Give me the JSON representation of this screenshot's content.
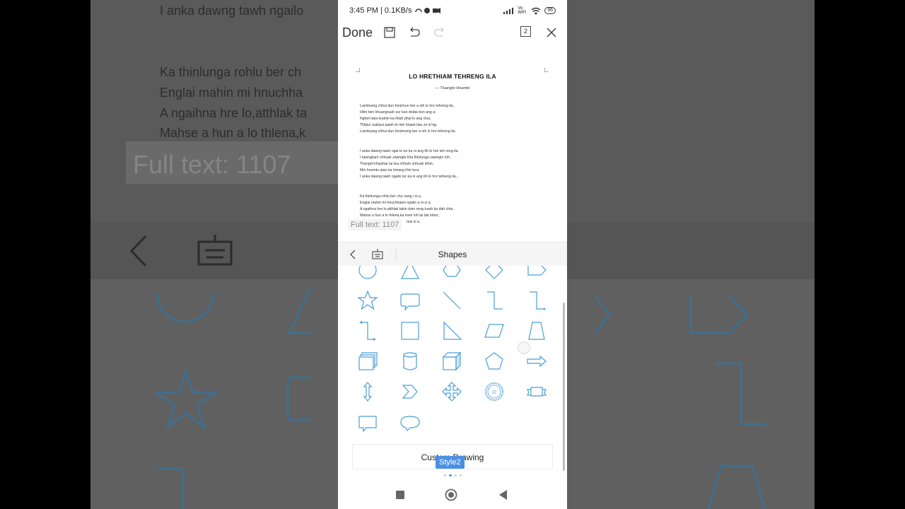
{
  "background": {
    "lines": [
      "I anka dawng tawh ngailo",
      "Ka thinlunga rohlu ber  ch",
      "Englai mahin mi hnuchha",
      "A ngaihna hre lo,atthlak ta",
      "Mahse a hun a lo thlena,k"
    ],
    "full_text": "Full text: 1107"
  },
  "status_bar": {
    "time_speed": "3:45 PM | 0.1KB/s",
    "network": "Vo WiFi",
    "battery": "96"
  },
  "toolbar": {
    "done_label": "Done",
    "page_count": "2"
  },
  "document": {
    "title": "LO HRETHIAM TEHRENG ILA",
    "author": "— Tluangte Hnamte",
    "lines": [
      "Lamtluang chhui dun hnuhnun ber a nih lo hre tehreng ila,",
      "Hlim tein khuangruah sur kan dodai dun ang a;",
      "Nghet taka kuahin ka thlah phal lo ang chia,",
      "Thlipui ruahpui pawh-in min hnawt ṭiau zo lo'ng;",
      "Lamtluang chhui dun hnuhnung ber a nih lo hre tehreng ila.",
      "I anka dawng tawh ngai lo tur ka ni ang tih lo hre teh reng ila,",
      "I tawngkam chhuak zawngte kha thinlunga vawngin loh;",
      "Thangril khawhar lai tea chham chhuak lehin,",
      "Min hnemtu atan ka hmang thin tura;",
      "I anka dawng tawh ngailo tur ka ni ang tih lo hre tehreng ila...",
      "Ka thinlunga rohlu ber  chu nang i ni a,",
      "Englai mahin mi hnuchhawn ngailo a ni si a;",
      "A ngaihna hre lo,atthlak takin dam reng turah ka dah chia,",
      "Mahse a hun a lo thlena,ka invin loh lai tak khan;",
      "mai si a.."
    ],
    "full_text_badge": "Full text: 1107"
  },
  "shapes_panel": {
    "title": "Shapes",
    "shapes": [
      "oval-shape",
      "triangle-shape",
      "hexagon-shape",
      "diamond-shape",
      "pentagon-arrow-shape",
      "star-shape",
      "rounded-callout-shape",
      "line-shape",
      "elbow-connector-shape",
      "elbow-connector-2-shape",
      "elbow-connector-3-shape",
      "square-shape",
      "right-triangle-shape",
      "parallelogram-shape",
      "trapezoid-shape",
      "stacked-docs-shape",
      "cylinder-shape",
      "cube-shape",
      "pentagon-shape",
      "right-arrow-shape",
      "up-down-arrow-shape",
      "chevron-shape",
      "quad-arrow-shape",
      "seal-32-shape",
      "ribbon-shape",
      "rect-callout-shape",
      "oval-callout-shape"
    ],
    "seal_label": "32",
    "custom_drawing_label": "Custom Drawing",
    "style_tooltip": "Style2"
  },
  "colors": {
    "shape_stroke": "#4a9fd8",
    "accent": "#4a90e2"
  }
}
